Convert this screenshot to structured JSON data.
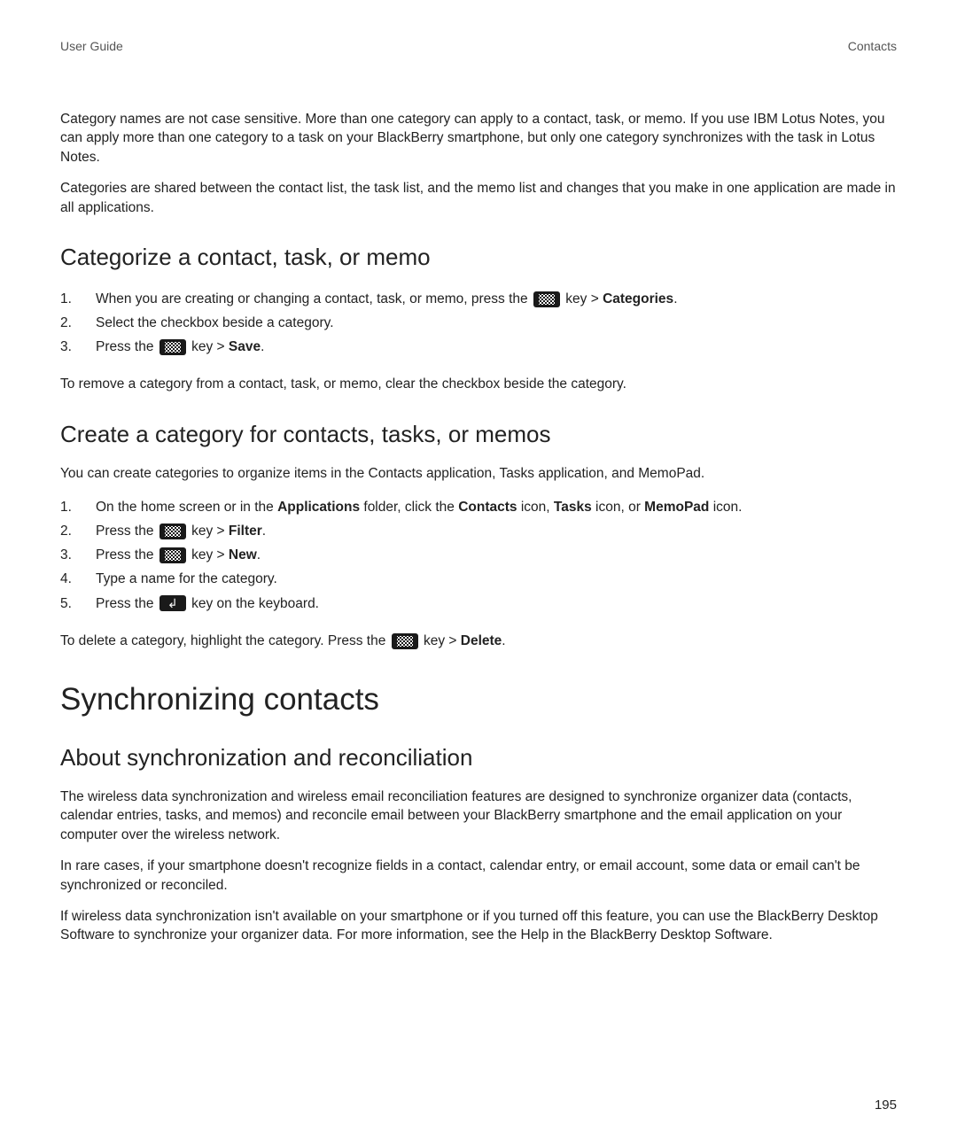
{
  "header": {
    "left": "User Guide",
    "right": "Contacts"
  },
  "intro": {
    "p1": "Category names are not case sensitive. More than one category can apply to a contact, task, or memo. If you use IBM Lotus Notes, you can apply more than one category to a task on your BlackBerry smartphone, but only one category synchronizes with the task in Lotus Notes.",
    "p2": "Categories are shared between the contact list, the task list, and the memo list and changes that you make in one application are made in all applications."
  },
  "section1": {
    "heading": "Categorize a contact, task, or memo",
    "items": {
      "i1_a": "When you are creating or changing a contact, task, or memo, press the ",
      "i1_b": " key > ",
      "i1_c": "Categories",
      "i1_d": ".",
      "i2": "Select the checkbox beside a category.",
      "i3_a": "Press the ",
      "i3_b": " key > ",
      "i3_c": "Save",
      "i3_d": "."
    },
    "after": "To remove a category from a contact, task, or memo, clear the checkbox beside the category."
  },
  "section2": {
    "heading": "Create a category for contacts, tasks, or memos",
    "intro": "You can create categories to organize items in the Contacts application, Tasks application, and MemoPad.",
    "items": {
      "i1_a": "On the home screen or in the ",
      "i1_b": "Applications",
      "i1_c": " folder, click the ",
      "i1_d": "Contacts",
      "i1_e": " icon, ",
      "i1_f": "Tasks",
      "i1_g": " icon, or ",
      "i1_h": "MemoPad",
      "i1_i": " icon.",
      "i2_a": "Press the ",
      "i2_b": " key > ",
      "i2_c": "Filter",
      "i2_d": ".",
      "i3_a": "Press the ",
      "i3_b": " key > ",
      "i3_c": "New",
      "i3_d": ".",
      "i4": "Type a name for the category.",
      "i5_a": "Press the ",
      "i5_b": " key on the keyboard."
    },
    "after_a": "To delete a category, highlight the category. Press the ",
    "after_b": " key > ",
    "after_c": "Delete",
    "after_d": "."
  },
  "section3": {
    "heading": "Synchronizing contacts",
    "sub": {
      "heading": "About synchronization and reconciliation",
      "p1": "The wireless data synchronization and wireless email reconciliation features are designed to synchronize organizer data (contacts, calendar entries, tasks, and memos) and reconcile email between your BlackBerry smartphone and the email application on your computer over the wireless network.",
      "p2": "In rare cases, if your smartphone doesn't recognize fields in a contact, calendar entry, or email account, some data or email can't be synchronized or reconciled.",
      "p3": "If wireless data synchronization isn't available on your smartphone or if you turned off this feature, you can use the BlackBerry Desktop Software to synchronize your organizer data. For more information, see the Help in the BlackBerry Desktop Software."
    }
  },
  "page_number": "195"
}
